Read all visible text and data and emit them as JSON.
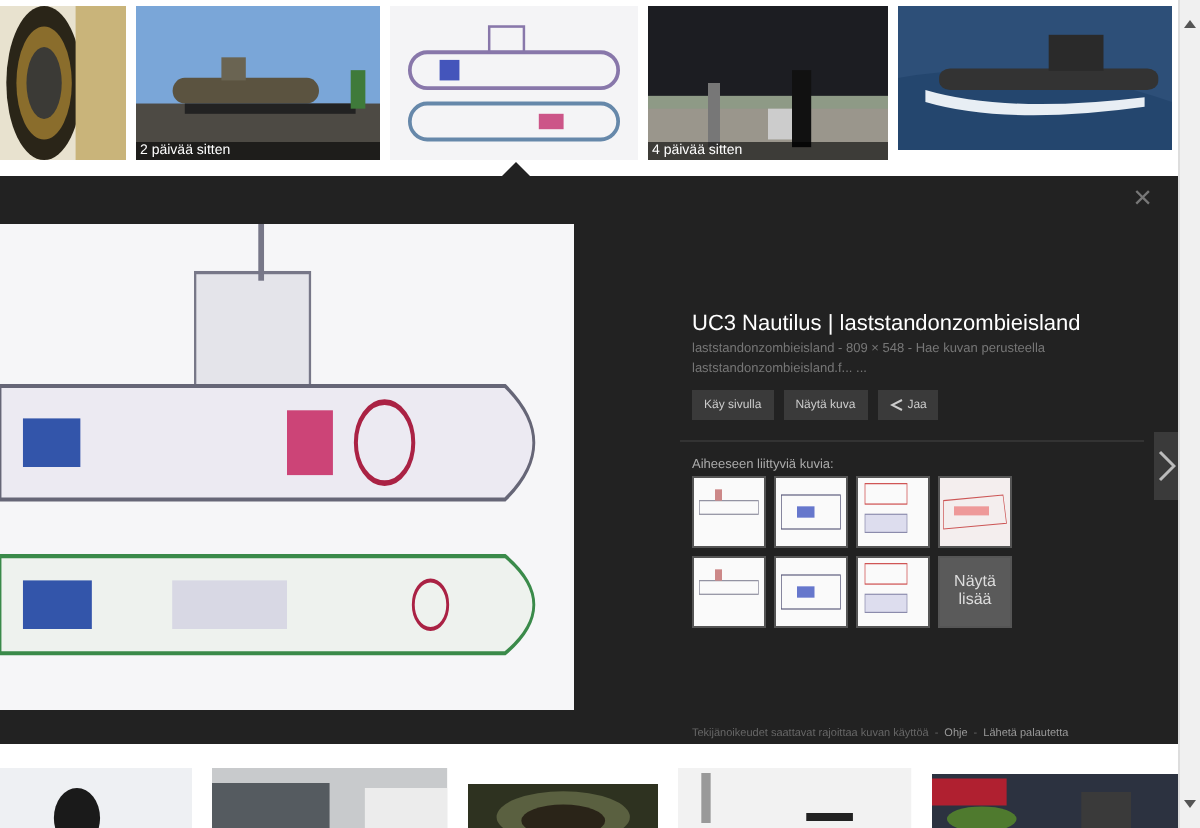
{
  "top_strip": [
    {
      "kind": "picture"
    },
    {
      "kind": "picture",
      "caption": "2 päivää sitten"
    },
    {
      "kind": "picture"
    },
    {
      "kind": "picture",
      "caption": "4 päivää sitten"
    },
    {
      "kind": "picture"
    }
  ],
  "viewer": {
    "close": "×",
    "title": "UC3 Nautilus | laststandonzombieisland",
    "meta": [
      "laststandonzombieisland - 809 × 548 - Hae kuvan perusteella",
      "laststandonzombieisland.f... ..."
    ],
    "buttons": [
      {
        "label": "Käy sivulla"
      },
      {
        "label": "Näytä kuva"
      },
      {
        "label": "Jaa",
        "kind": "share"
      }
    ],
    "related_heading": "Aiheeseen liittyviä kuvia:",
    "related": [
      {
        "kind": "picture"
      },
      {
        "kind": "picture"
      },
      {
        "kind": "picture"
      },
      {
        "kind": "picture"
      },
      {
        "kind": "picture"
      },
      {
        "kind": "picture"
      },
      {
        "kind": "picture"
      },
      {
        "kind": "more",
        "label": "Näytä lisää"
      }
    ],
    "footer": [
      {
        "kind": "note",
        "text": "Tekijänoikeudet saattavat rajoittaa kuvan käyttöä"
      },
      {
        "kind": "separator",
        "text": "-"
      },
      {
        "kind": "link",
        "text": "Ohje"
      },
      {
        "kind": "separator",
        "text": "-"
      },
      {
        "kind": "link",
        "text": "Lähetä palautetta"
      }
    ]
  },
  "bottom_strip": [
    {
      "kind": "picture"
    },
    {
      "kind": "picture"
    },
    {
      "kind": "picture"
    },
    {
      "kind": "picture"
    },
    {
      "kind": "picture"
    }
  ]
}
